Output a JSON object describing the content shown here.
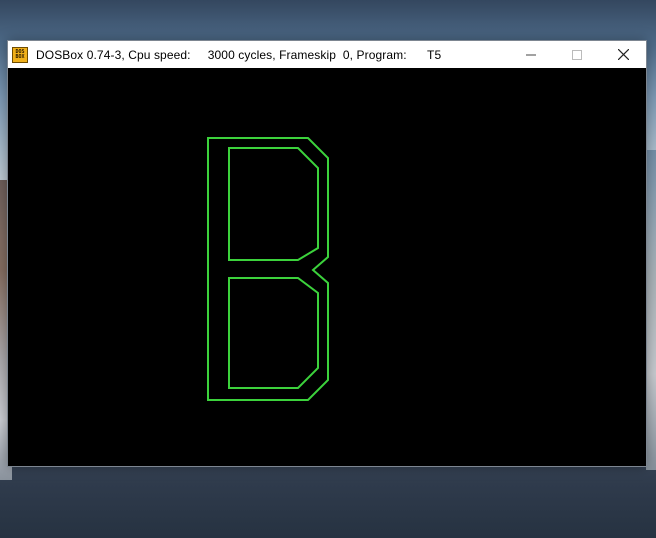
{
  "window": {
    "title": "DOSBox 0.74-3, Cpu speed:     3000 cycles, Frameskip  0, Program:      T5",
    "app_icon": {
      "name": "dosbox-icon",
      "label_top": "DOS",
      "label_bottom": "BOX",
      "color": "#f0b01a"
    },
    "controls": {
      "minimize_icon": "minimize-icon",
      "maximize_icon": "maximize-icon",
      "close_icon": "close-icon"
    }
  },
  "screen": {
    "background": "#000000",
    "glyph": {
      "letter": "B",
      "style": "outline",
      "color": "#3cd23c"
    }
  }
}
